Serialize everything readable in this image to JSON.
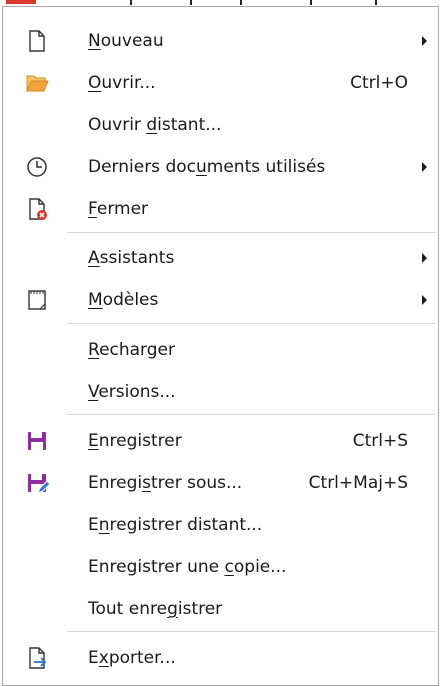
{
  "menu": {
    "items": [
      {
        "label": "Nouveau",
        "u": "N",
        "shortcut": "",
        "submenu": true,
        "icon": "new-document-icon"
      },
      {
        "label": "Ouvrir...",
        "u": "O",
        "shortcut": "Ctrl+O",
        "submenu": false,
        "icon": "open-folder-icon"
      },
      {
        "label": "Ouvrir distant...",
        "u": "d",
        "shortcut": "",
        "submenu": false,
        "icon": ""
      },
      {
        "label": "Derniers documents utilisés",
        "u": "u",
        "shortcut": "",
        "submenu": true,
        "icon": "recent-clock-icon"
      },
      {
        "label": "Fermer",
        "u": "F",
        "shortcut": "",
        "submenu": false,
        "icon": "close-document-icon"
      },
      {
        "label": "Assistants",
        "u": "A",
        "shortcut": "",
        "submenu": true,
        "icon": ""
      },
      {
        "label": "Modèles",
        "u": "M",
        "shortcut": "",
        "submenu": true,
        "icon": "templates-icon"
      },
      {
        "label": "Recharger",
        "u": "R",
        "shortcut": "",
        "submenu": false,
        "icon": ""
      },
      {
        "label": "Versions...",
        "u": "V",
        "shortcut": "",
        "submenu": false,
        "icon": ""
      },
      {
        "label": "Enregistrer",
        "u": "E",
        "shortcut": "Ctrl+S",
        "submenu": false,
        "icon": "save-icon"
      },
      {
        "label": "Enregistrer sous...",
        "u": "s",
        "shortcut": "Ctrl+Maj+S",
        "submenu": false,
        "icon": "save-as-icon"
      },
      {
        "label": "Enregistrer distant...",
        "u": "n",
        "shortcut": "",
        "submenu": false,
        "icon": ""
      },
      {
        "label": "Enregistrer une copie...",
        "u": "c",
        "shortcut": "",
        "submenu": false,
        "icon": ""
      },
      {
        "label": "Tout enregistrer",
        "u": "g",
        "shortcut": "",
        "submenu": false,
        "icon": ""
      },
      {
        "label": "Exporter...",
        "u": "x",
        "shortcut": "",
        "submenu": false,
        "icon": "export-icon"
      }
    ]
  },
  "colors": {
    "save_purple": "#8e2d9e",
    "folder_orange": "#f2a33a",
    "close_red": "#e0332d",
    "export_blue": "#2b6fd6",
    "text": "#1a1a1a"
  }
}
